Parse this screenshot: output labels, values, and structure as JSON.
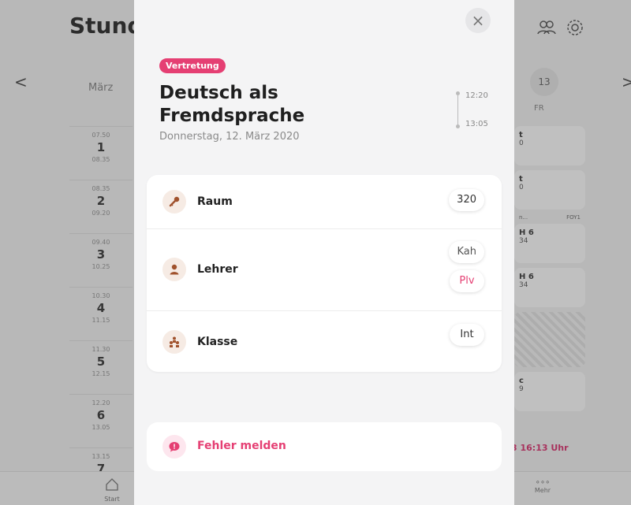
{
  "background": {
    "title": "Stund",
    "nav_prev": "<",
    "nav_next": ">",
    "month": "März",
    "day_number": "13",
    "day_name": "FR",
    "periods": [
      {
        "start": "07.50",
        "number": "1",
        "end": "08.35"
      },
      {
        "start": "08.35",
        "number": "2",
        "end": "09.20"
      },
      {
        "start": "09.40",
        "number": "3",
        "end": "10.25"
      },
      {
        "start": "10.30",
        "number": "4",
        "end": "11.15"
      },
      {
        "start": "11.30",
        "number": "5",
        "end": "12.15"
      },
      {
        "start": "12.20",
        "number": "6",
        "end": "13.05"
      },
      {
        "start": "13.15",
        "number": "7",
        "end": ""
      }
    ],
    "cells": [
      {
        "line1": "t",
        "line2": "0"
      },
      {
        "line1": "t",
        "line2": "0"
      },
      {
        "line1": "H 6",
        "line2": "34"
      },
      {
        "line1": "H 6",
        "line2": "34"
      }
    ],
    "foy_left": "n...",
    "foy_right": "FOY1",
    "bottom_cell": {
      "line1": "c",
      "line2": "9"
    },
    "alert_text": "3 16:13 Uhr",
    "tab_start": "Start",
    "tab_more_dots": "∘∘∘",
    "tab_more": "Mehr"
  },
  "modal": {
    "close_symbol": "×",
    "badge": "Vertretung",
    "title": "Deutsch als Fremdsprache",
    "subtitle": "Donnerstag, 12. März 2020",
    "time_start": "12:20",
    "time_end": "13:05",
    "rows": {
      "room": {
        "label": "Raum",
        "icon": "key-icon",
        "value": "320"
      },
      "teacher": {
        "label": "Lehrer",
        "icon": "person-icon",
        "value": "Kah",
        "alt_value": "Plv"
      },
      "class": {
        "label": "Klasse",
        "icon": "group-icon",
        "value": "Int"
      }
    },
    "report": {
      "label": "Fehler melden",
      "icon": "speech-bubble-icon"
    }
  },
  "colors": {
    "accent": "#e53f73",
    "icon_brown": "#a0522d",
    "icon_bg": "#f6ebe4"
  }
}
